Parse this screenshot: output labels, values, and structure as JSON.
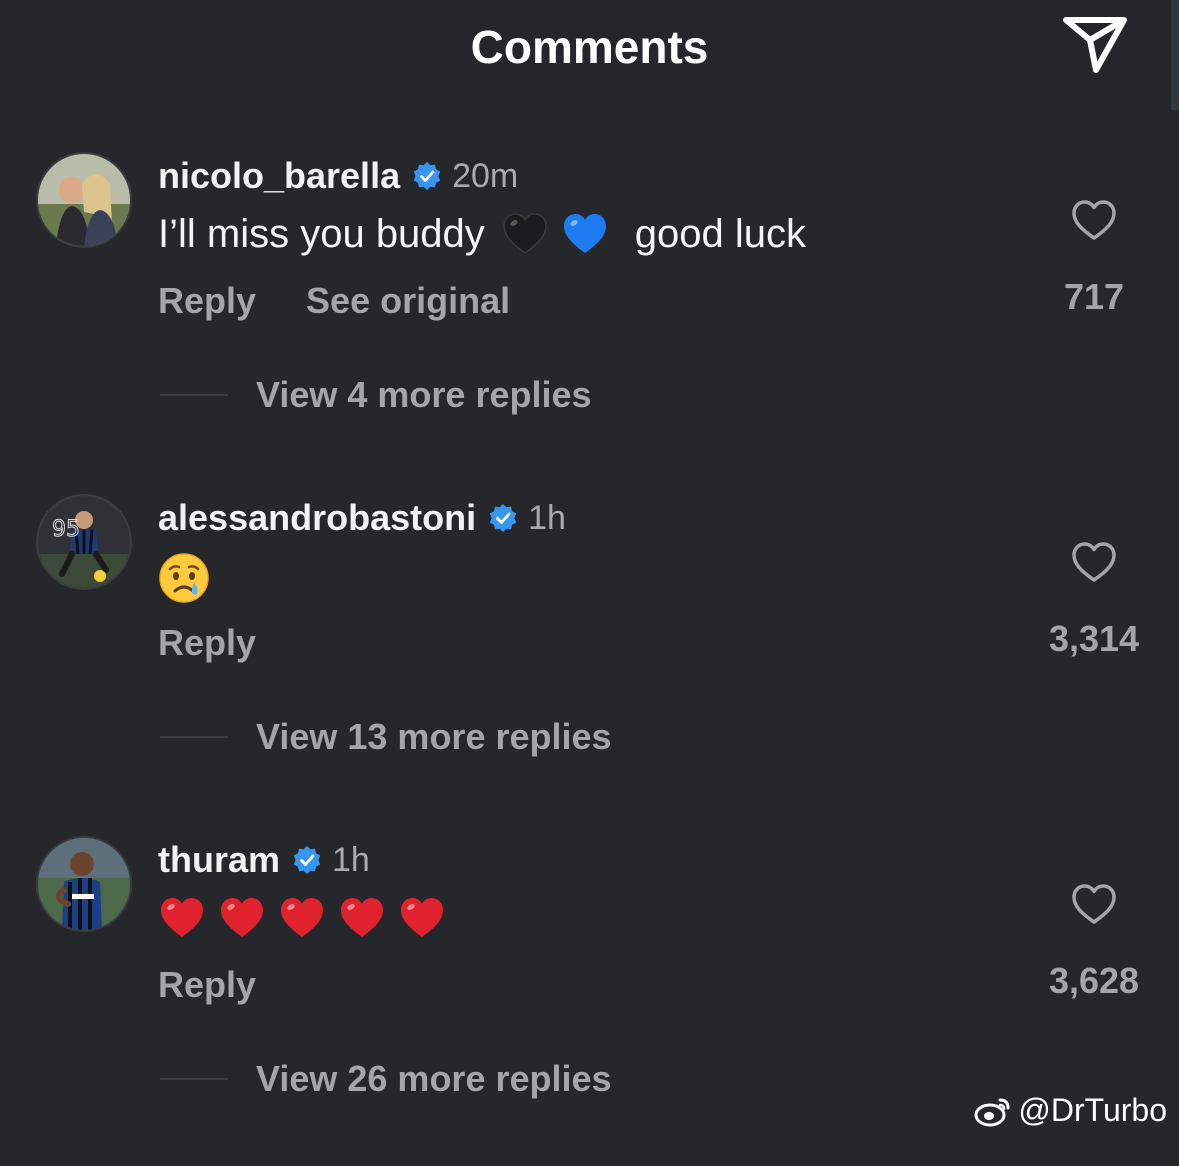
{
  "header": {
    "title": "Comments",
    "send_icon": "paper-plane-icon"
  },
  "comments": [
    {
      "username": "nicolo_barella",
      "verified": true,
      "time": "20m",
      "text_before": "I’ll miss you buddy",
      "emojis": [
        "🖤",
        "💙"
      ],
      "text_after": "good luck",
      "actions": [
        "Reply",
        "See original"
      ],
      "likes": "717",
      "view_replies": "View 4 more replies"
    },
    {
      "username": "alessandrobastoni",
      "verified": true,
      "time": "1h",
      "emojis": [
        "😢"
      ],
      "actions": [
        "Reply"
      ],
      "likes": "3,314",
      "view_replies": "View 13 more replies"
    },
    {
      "username": "thuram",
      "verified": true,
      "time": "1h",
      "emojis": [
        "❤️",
        "❤️",
        "❤️",
        "❤️",
        "❤️"
      ],
      "actions": [
        "Reply"
      ],
      "likes": "3,628",
      "view_replies": "View 26 more replies"
    }
  ],
  "watermark": "@DrTurbo",
  "colors": {
    "background": "#25272b",
    "verified": "#3797f0",
    "muted_text": "#a2a5aa",
    "heart_red": "#e0212e",
    "heart_blue": "#1e7cf2"
  }
}
